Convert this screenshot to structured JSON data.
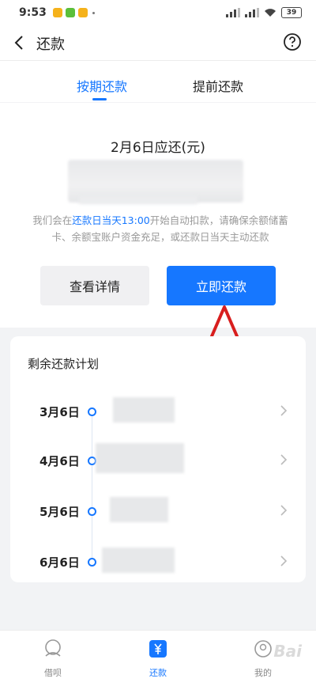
{
  "status_bar": {
    "time": "9:53",
    "battery": "39"
  },
  "header": {
    "title": "还款"
  },
  "tabs": [
    {
      "label": "按期还款",
      "active": true
    },
    {
      "label": "提前还款",
      "active": false
    }
  ],
  "due": {
    "title": "2月6日应还(元)",
    "notice_prefix": "我们会在",
    "notice_highlight": "还款日当天13:00",
    "notice_suffix": "开始自动扣款，请确保余额储蓄卡、余额宝账户资金充足，或还款日当天主动还款"
  },
  "buttons": {
    "detail": "查看详情",
    "pay_now": "立即还款"
  },
  "plan": {
    "title": "剩余还款计划",
    "items": [
      {
        "date": "3月6日"
      },
      {
        "date": "4月6日"
      },
      {
        "date": "5月6日"
      },
      {
        "date": "6月6日"
      }
    ]
  },
  "bottom_nav": [
    {
      "label": "借呗",
      "icon": "jiebei-icon",
      "active": false
    },
    {
      "label": "还款",
      "icon": "yuan-icon",
      "active": true
    },
    {
      "label": "我的",
      "icon": "profile-icon",
      "active": false
    }
  ],
  "watermark": "Bai",
  "colors": {
    "accent": "#1677ff",
    "annotation": "#d81e1e"
  }
}
